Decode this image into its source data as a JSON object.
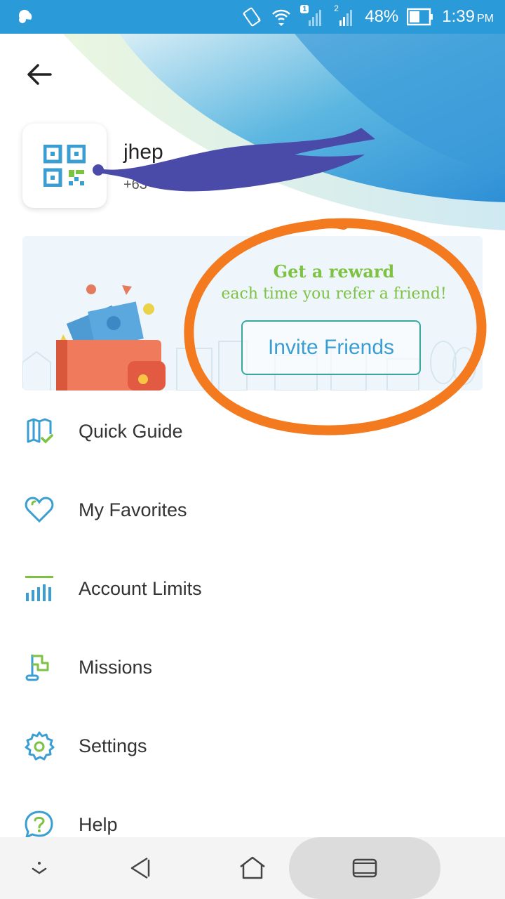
{
  "status_bar": {
    "sim1_badge": "1",
    "sim2_badge": "2",
    "battery_percent": "48%",
    "time": "1:39",
    "time_suffix": "PM"
  },
  "profile": {
    "name": "jhep",
    "phone": "+63"
  },
  "banner": {
    "title": "Get a reward",
    "subtitle": "each time you refer a friend!",
    "invite_label": "Invite Friends"
  },
  "menu": {
    "items": [
      {
        "label": "Quick Guide",
        "icon": "book-check-icon"
      },
      {
        "label": "My Favorites",
        "icon": "heart-icon"
      },
      {
        "label": "Account Limits",
        "icon": "bar-chart-icon"
      },
      {
        "label": "Missions",
        "icon": "flag-icon"
      },
      {
        "label": "Settings",
        "icon": "gear-icon"
      },
      {
        "label": "Help",
        "icon": "help-bubble-icon"
      }
    ]
  },
  "colors": {
    "status_bar": "#2b9ad8",
    "accent_blue": "#3a9ed3",
    "accent_green": "#7dc242",
    "highlight_orange": "#f47a20",
    "scribble_purple": "#4a4aa8"
  }
}
